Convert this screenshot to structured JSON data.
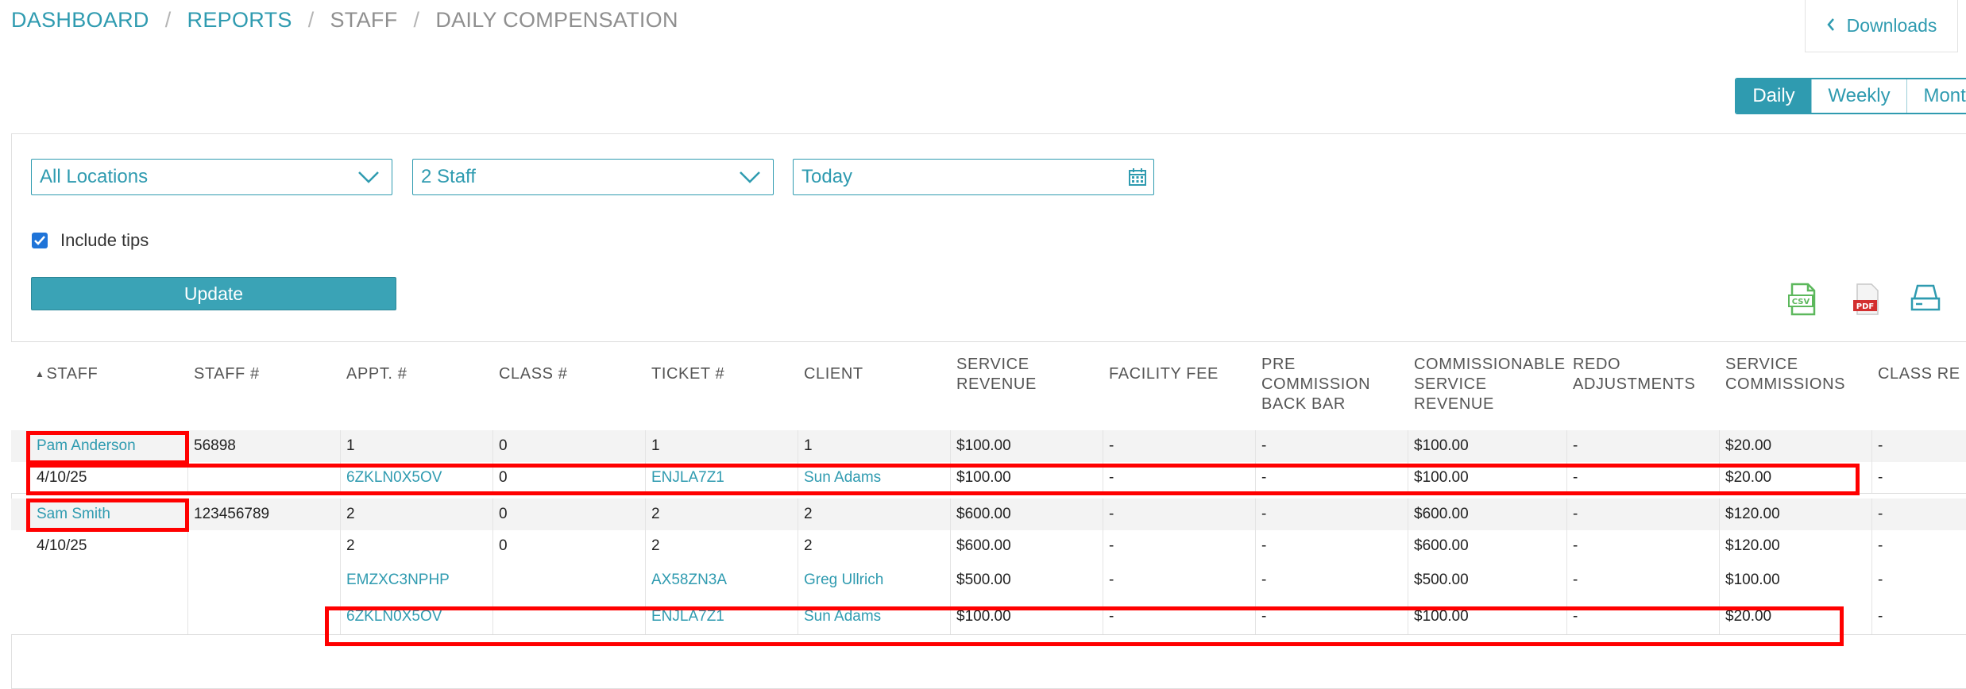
{
  "breadcrumb": {
    "items": [
      "DASHBOARD",
      "REPORTS",
      "STAFF",
      "DAILY COMPENSATION"
    ],
    "separator": "/"
  },
  "downloads": {
    "label": "Downloads"
  },
  "period": {
    "options": [
      "Daily",
      "Weekly",
      "Monthly"
    ],
    "selected": "Daily"
  },
  "filters": {
    "location": "All Locations",
    "staff": "2 Staff",
    "date": "Today",
    "include_tips_label": "Include tips",
    "include_tips_checked": true
  },
  "update_button": "Update",
  "export": {
    "csv_icon": "csv-file-icon",
    "pdf_icon": "pdf-file-icon",
    "print_icon": "print-icon"
  },
  "table": {
    "sort_indicator": "▲",
    "columns": [
      "STAFF",
      "STAFF #",
      "APPT. #",
      "CLASS #",
      "TICKET #",
      "CLIENT",
      "SERVICE\nREVENUE",
      "FACILITY FEE",
      "PRE\nCOMMISSION\nBACK BAR",
      "COMMISSIONABLE\nSERVICE\nREVENUE",
      "REDO\nADJUSTMENTS",
      "SERVICE\nCOMMISSIONS",
      "CLASS RE"
    ],
    "groups": [
      {
        "summary": [
          "Pam Anderson",
          "56898",
          "1",
          "0",
          "1",
          "1",
          "$100.00",
          "-",
          "-",
          "$100.00",
          "-",
          "$20.00",
          "-"
        ],
        "rows": [
          [
            "4/10/25",
            "",
            "6ZKLN0X5OV",
            "0",
            "ENJLA7Z1",
            "Sun Adams",
            "$100.00",
            "-",
            "-",
            "$100.00",
            "-",
            "$20.00",
            "-"
          ]
        ]
      },
      {
        "summary": [
          "Sam Smith",
          "123456789",
          "2",
          "0",
          "2",
          "2",
          "$600.00",
          "-",
          "-",
          "$600.00",
          "-",
          "$120.00",
          "-"
        ],
        "rows": [
          [
            "4/10/25",
            "",
            "2",
            "0",
            "2",
            "2",
            "$600.00",
            "-",
            "-",
            "$600.00",
            "-",
            "$120.00",
            "-"
          ],
          [
            "",
            "",
            "EMZXC3NPHP",
            "",
            "AX58ZN3A",
            "Greg Ullrich",
            "$500.00",
            "-",
            "-",
            "$500.00",
            "-",
            "$100.00",
            "-"
          ],
          [
            "",
            "",
            "6ZKLN0X5OV",
            "",
            "ENJLA7Z1",
            "Sun Adams",
            "$100.00",
            "-",
            "-",
            "$100.00",
            "-",
            "$20.00",
            "-"
          ]
        ]
      }
    ]
  },
  "colors": {
    "accent": "#2f9bb0",
    "highlight": "#ff0000",
    "checkbox": "#1f74d8"
  }
}
